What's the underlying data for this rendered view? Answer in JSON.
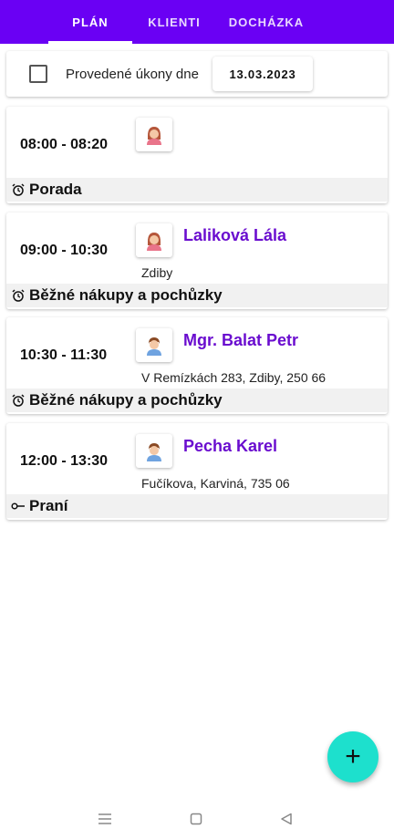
{
  "tabs": [
    {
      "label": "PLÁN",
      "active": true
    },
    {
      "label": "KLIENTI",
      "active": false
    },
    {
      "label": "DOCHÁZKA",
      "active": false
    }
  ],
  "filter": {
    "checkbox_checked": false,
    "label": "Provedené úkony dne",
    "date": "13.03.2023"
  },
  "appointments": [
    {
      "time": "08:00 - 08:20",
      "avatar": "female-avatar-icon",
      "client": "",
      "address": "",
      "task_icon": "alarm-clock-icon",
      "task": "Porada"
    },
    {
      "time": "09:00 - 10:30",
      "avatar": "female-avatar-icon",
      "client": "Laliková Lála",
      "address": "Zdiby",
      "task_icon": "alarm-clock-icon",
      "task": "Běžné nákupy a pochůzky"
    },
    {
      "time": "10:30 - 11:30",
      "avatar": "male-avatar-icon",
      "client": "Mgr. Balat Petr",
      "address": "V Remízkách 283, Zdiby, 250 66",
      "task_icon": "alarm-clock-icon",
      "task": "Běžné nákupy a pochůzky"
    },
    {
      "time": "12:00 - 13:30",
      "avatar": "male-avatar-icon",
      "client": "Pecha Karel",
      "address": "Fučíkova, Karviná, 735 06",
      "task_icon": "key-icon",
      "task": "Praní"
    }
  ],
  "fab": {
    "label": "+",
    "icon": "plus-icon"
  },
  "navbar": {
    "icons": [
      "menu-icon",
      "home-square-icon",
      "back-triangle-icon"
    ]
  },
  "colors": {
    "primary": "#6a00f4",
    "client_name": "#6a0dcf",
    "fab": "#1de0cd"
  }
}
